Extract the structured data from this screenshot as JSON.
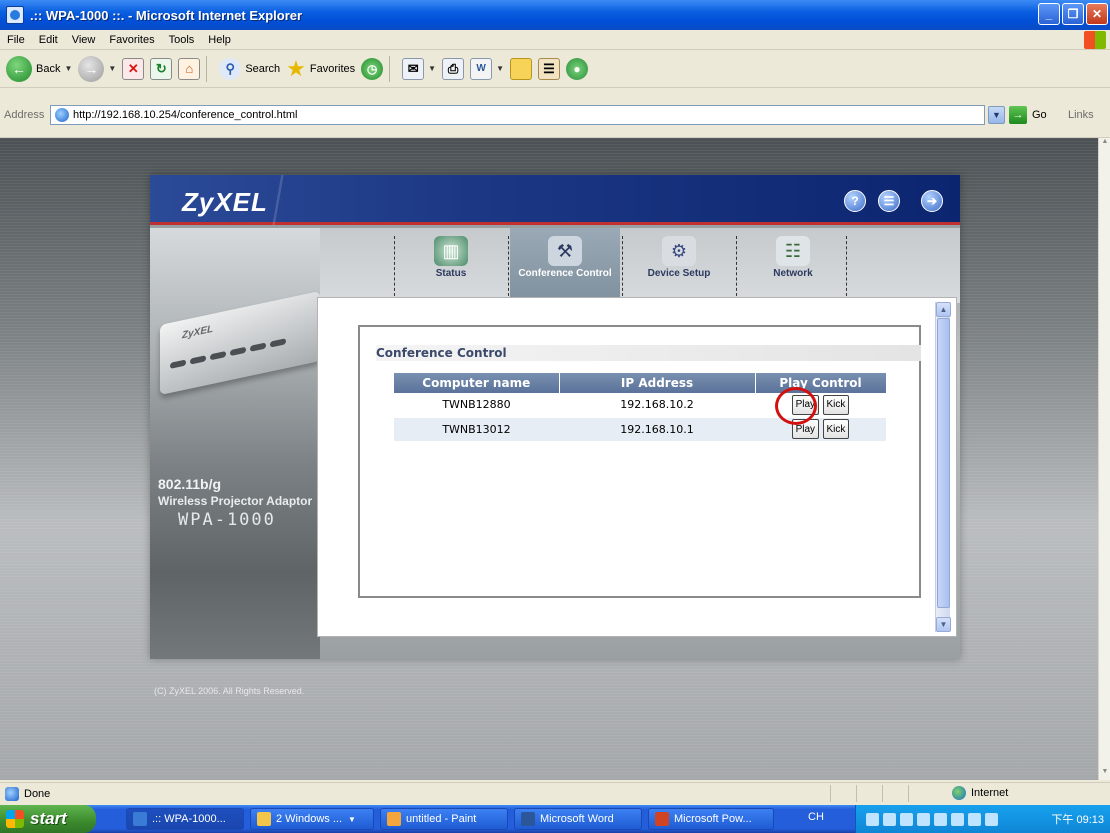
{
  "window": {
    "title": ".:: WPA-1000 ::. - Microsoft Internet Explorer",
    "buttons": [
      "_",
      "❐",
      "✕"
    ]
  },
  "menu": [
    "File",
    "Edit",
    "View",
    "Favorites",
    "Tools",
    "Help"
  ],
  "toolbar": {
    "back_label": "Back",
    "search_label": "Search",
    "favorites_label": "Favorites"
  },
  "address": {
    "label": "Address",
    "url": "http://192.168.10.254/conference_control.html",
    "go_label": "Go",
    "links_label": "Links"
  },
  "zyxel": {
    "logo": "ZyXEL",
    "device_brand": "ZyXEL",
    "product_line1": "802.11b/g",
    "product_line2": "Wireless Projector Adaptor",
    "product_model": "WPA-1000",
    "copyright": "(C) ZyXEL 2006. All Rights Reserved.",
    "header_icons": [
      "help-icon",
      "notes-icon",
      "logout-icon"
    ],
    "nav": [
      {
        "label": "Status",
        "icon": "status-icon"
      },
      {
        "label": "Conference Control",
        "icon": "conference-control-icon",
        "active": true
      },
      {
        "label": "Device Setup",
        "icon": "device-setup-icon"
      },
      {
        "label": "Network",
        "icon": "network-icon"
      }
    ]
  },
  "conference": {
    "title": "Conference Control",
    "headers": [
      "Computer name",
      "IP Address",
      "Play Control"
    ],
    "rows": [
      {
        "computer": "TWNB12880",
        "ip": "192.168.10.2",
        "play": "Play",
        "kick": "Kick"
      },
      {
        "computer": "TWNB13012",
        "ip": "192.168.10.1",
        "play": "Play",
        "kick": "Kick"
      }
    ]
  },
  "status": {
    "text": "Done",
    "zone": "Internet"
  },
  "taskbar": {
    "start": "start",
    "tasks": [
      {
        "label": ".:: WPA-1000...",
        "color": "#3a7bd5"
      },
      {
        "label": "2 Windows ...",
        "color": "#f3c64a"
      },
      {
        "label": "untitled - Paint",
        "color": "#f4a53b"
      },
      {
        "label": "Microsoft Word",
        "color": "#2b579a"
      },
      {
        "label": "Microsoft Pow...",
        "color": "#d04423"
      }
    ],
    "lang": "CH",
    "clock": "下午 09:13"
  }
}
